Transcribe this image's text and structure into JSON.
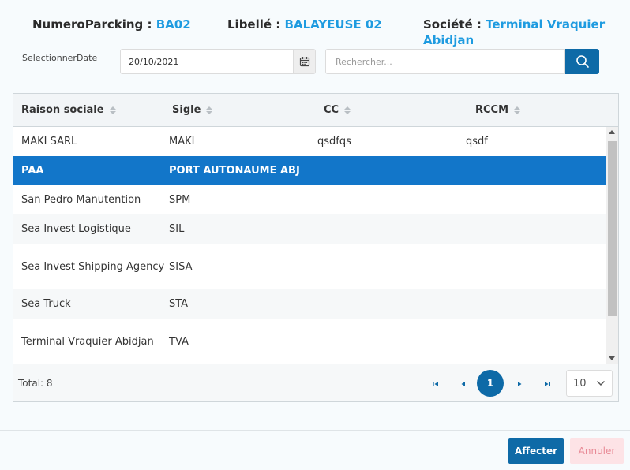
{
  "header": {
    "numero_label": "NumeroParcking :",
    "numero_value": "BA02",
    "libelle_label": "Libellé :",
    "libelle_value": "BALAYEUSE 02",
    "societe_label": "Société :",
    "societe_value": "Terminal Vraquier Abidjan"
  },
  "filters": {
    "date_label": "SelectionnerDate",
    "date_value": "20/10/2021",
    "search_placeholder": "Rechercher..."
  },
  "table": {
    "columns": [
      "Raison sociale",
      "Sigle",
      "CC",
      "RCCM"
    ],
    "rows": [
      {
        "raison": "MAKI SARL",
        "sigle": "MAKI",
        "cc": "qsdfqs",
        "rccm": "qsdf"
      },
      {
        "raison": "PAA",
        "sigle": "PORT AUTONAUME ABJ",
        "cc": "",
        "rccm": ""
      },
      {
        "raison": "San Pedro Manutention",
        "sigle": "SPM",
        "cc": "",
        "rccm": ""
      },
      {
        "raison": "Sea Invest Logistique",
        "sigle": "SIL",
        "cc": "",
        "rccm": ""
      },
      {
        "raison": "Sea Invest Shipping Agency",
        "sigle": "SISA",
        "cc": "",
        "rccm": ""
      },
      {
        "raison": "Sea Truck",
        "sigle": "STA",
        "cc": "",
        "rccm": ""
      },
      {
        "raison": "Terminal Vraquier Abidjan",
        "sigle": "TVA",
        "cc": "",
        "rccm": ""
      }
    ],
    "selected_row_index": 1
  },
  "pager": {
    "total": "Total: 8",
    "current_page": "1",
    "page_size": "10"
  },
  "actions": {
    "affecter": "Affecter",
    "annuler": "Annuler"
  },
  "colors": {
    "accent": "#0e6aa7",
    "link_value": "#1e9be0",
    "selected_row": "#1276c9",
    "cancel_bg": "#fde3e6"
  },
  "icons": [
    "calendar-icon",
    "search-icon",
    "sort-icon",
    "first-page-icon",
    "prev-page-icon",
    "next-page-icon",
    "last-page-icon",
    "chevron-down-icon"
  ]
}
